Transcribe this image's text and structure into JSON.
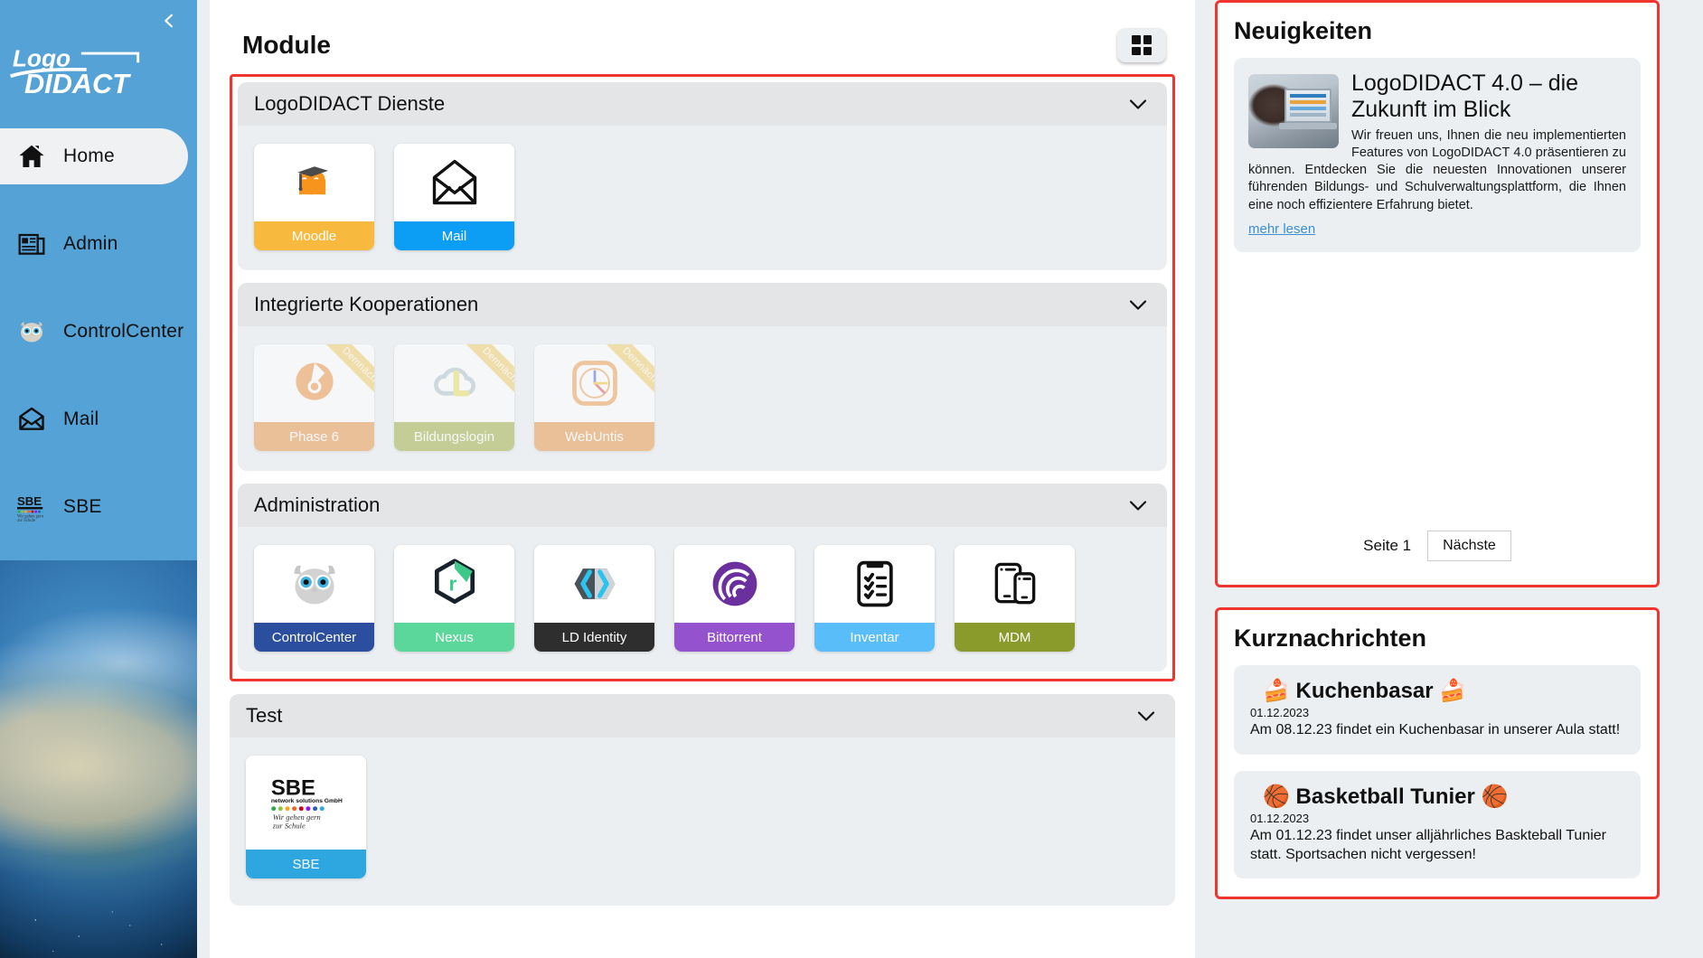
{
  "sidebar": {
    "collapse_icon": "chevron-left-icon",
    "brand": "LogoDIDACT",
    "items": [
      {
        "label": "Home",
        "icon": "home-icon",
        "active": true
      },
      {
        "label": "Admin",
        "icon": "newspaper-icon",
        "active": false
      },
      {
        "label": "ControlCenter",
        "icon": "owl-icon",
        "active": false
      },
      {
        "label": "Mail",
        "icon": "envelope-icon",
        "active": false
      },
      {
        "label": "SBE",
        "icon": "sbe-logo-icon",
        "active": false
      }
    ]
  },
  "modules": {
    "title": "Module",
    "grid_toggle_icon": "grid-view-icon",
    "chevron_icon": "chevron-down-icon",
    "ribbon_label": "Demnächst",
    "sections": [
      {
        "title": "LogoDIDACT Dienste",
        "tiles": [
          {
            "label": "Moodle",
            "icon": "moodle-icon",
            "color": "#f8b93f",
            "soon": false
          },
          {
            "label": "Mail",
            "icon": "envelope-icon",
            "color": "#0c9ef5",
            "soon": false
          }
        ]
      },
      {
        "title": "Integrierte Kooperationen",
        "tiles": [
          {
            "label": "Phase 6",
            "icon": "phase6-icon",
            "color": "#e89a4f",
            "soon": true
          },
          {
            "label": "Bildungslogin",
            "icon": "bildungslogin-icon",
            "color": "#a3b34a",
            "soon": true
          },
          {
            "label": "WebUntis",
            "icon": "webuntis-icon",
            "color": "#e89a4f",
            "soon": true
          }
        ]
      },
      {
        "title": "Administration",
        "tiles": [
          {
            "label": "ControlCenter",
            "icon": "owl-icon",
            "color": "#2b4f9e",
            "soon": false
          },
          {
            "label": "Nexus",
            "icon": "nexus-icon",
            "color": "#5cd79b",
            "soon": false
          },
          {
            "label": "LD Identity",
            "icon": "identity-icon",
            "color": "#2e2e2e",
            "soon": false
          },
          {
            "label": "Bittorrent",
            "icon": "bittorrent-icon",
            "color": "#9452cf",
            "soon": false
          },
          {
            "label": "Inventar",
            "icon": "clipboard-icon",
            "color": "#58bdf8",
            "soon": false
          },
          {
            "label": "MDM",
            "icon": "devices-icon",
            "color": "#8a9a2b",
            "soon": false
          }
        ]
      },
      {
        "title": "Test",
        "tiles": [
          {
            "label": "SBE",
            "icon": "sbe-logo-icon",
            "color": "#2ea7e0",
            "soon": false
          }
        ]
      }
    ]
  },
  "news": {
    "title": "Neuigkeiten",
    "article": {
      "thumb_icon": "person-laptop-photo",
      "headline": "LogoDIDACT 4.0 – die Zukunft im Blick",
      "body": "Wir freuen uns, Ihnen die neu implementierten Features von LogoDIDACT 4.0 präsentieren zu können. Entdecken Sie die neuesten Innovationen unserer führenden Bildungs- und Schulverwaltungsplattform, die Ihnen eine noch effizientere Erfahrung bietet.",
      "more_label": "mehr lesen"
    },
    "pager": {
      "page_label": "Seite 1",
      "next_label": "Nächste"
    }
  },
  "shortnews": {
    "title": "Kurznachrichten",
    "items": [
      {
        "headline": "🍰 Kuchenbasar 🍰",
        "date": "01.12.2023",
        "text": "Am 08.12.23 findet ein Kuchenbasar in unserer Aula statt!"
      },
      {
        "headline": "🏀 Basketball Tunier 🏀",
        "date": "01.12.2023",
        "text": "Am 01.12.23 findet unser alljährliches Baskteball Tunier statt. Sportsachen nicht vergessen!"
      }
    ]
  },
  "colors": {
    "sidebar_bg": "#55a2d6",
    "accent_red": "#f0342e",
    "page_bg": "#eceff1",
    "link": "#3a8fd0"
  }
}
